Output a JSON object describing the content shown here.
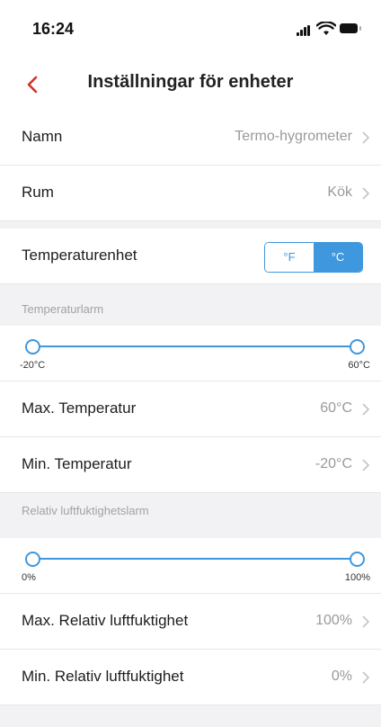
{
  "status_bar": {
    "time": "16:24"
  },
  "nav": {
    "title": "Inställningar för enheter"
  },
  "device": {
    "name_label": "Namn",
    "name_value": "Termo-hygrometer",
    "room_label": "Rum",
    "room_value": "Kök"
  },
  "temperature_unit": {
    "label": "Temperaturenhet",
    "options": [
      "°F",
      "°C"
    ],
    "selected": "°C"
  },
  "temperature_alarm": {
    "header": "Temperaturlarm",
    "slider_min_label": "-20°C",
    "slider_max_label": "60°C",
    "slider_low": -20,
    "slider_high": 60,
    "max_label": "Max. Temperatur",
    "max_value": "60°C",
    "min_label": "Min. Temperatur",
    "min_value": "-20°C"
  },
  "humidity_alarm": {
    "header": "Relativ luftfuktighetslarm",
    "slider_min_label": "0%",
    "slider_max_label": "100%",
    "slider_low": 0,
    "slider_high": 100,
    "max_label": "Max. Relativ luftfuktighet",
    "max_value": "100%",
    "min_label": "Min. Relativ luftfuktighet",
    "min_value": "0%"
  },
  "colors": {
    "accent": "#3f97dd",
    "back_arrow": "#d0322b",
    "background": "#f2f2f4"
  }
}
